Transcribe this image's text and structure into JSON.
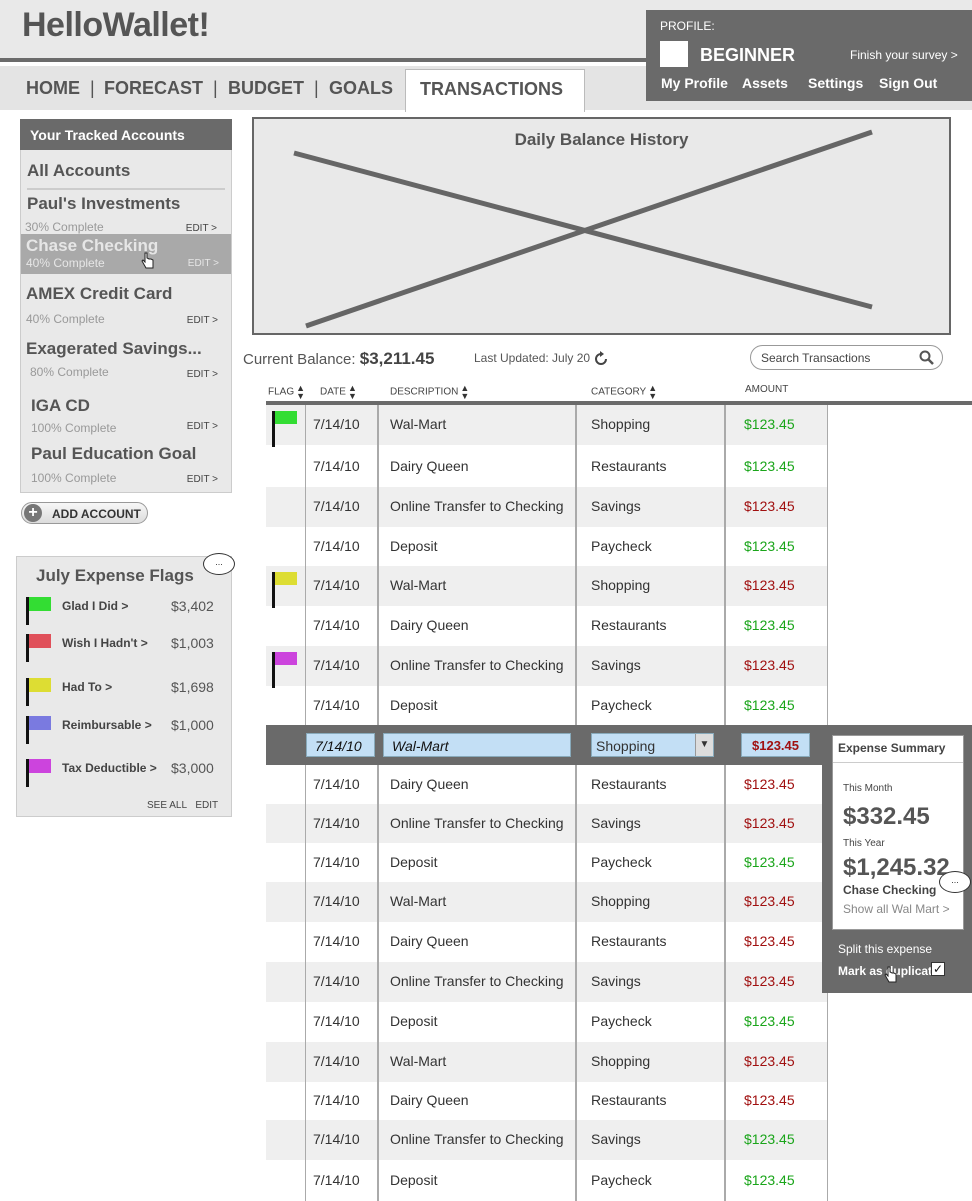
{
  "app": {
    "title": "HelloWallet!"
  },
  "nav": {
    "items": [
      "HOME",
      "FORECAST",
      "BUDGET",
      "GOALS",
      "TRANSACTIONS"
    ],
    "separator": "|",
    "active": "TRANSACTIONS"
  },
  "profile": {
    "label": "PROFILE:",
    "level": "BEGINNER",
    "survey_link": "Finish your survey >",
    "links": [
      "My Profile",
      "Assets",
      "Settings",
      "Sign Out"
    ]
  },
  "accounts": {
    "header": "Your Tracked Accounts",
    "all": "All Accounts",
    "items": [
      {
        "name": "Paul's Investments",
        "progress": "30% Complete",
        "edit": "EDIT >"
      },
      {
        "name": "Chase Checking",
        "progress": "40% Complete",
        "edit": "EDIT >"
      },
      {
        "name": "AMEX Credit Card",
        "progress": "40% Complete",
        "edit": "EDIT >"
      },
      {
        "name": "Exagerated Savings...",
        "progress": "80% Complete",
        "edit": "EDIT >"
      },
      {
        "name": "IGA CD",
        "progress": "100% Complete",
        "edit": "EDIT >"
      },
      {
        "name": "Paul Education Goal",
        "progress": "100% Complete",
        "edit": "EDIT >"
      }
    ],
    "selected": "Chase Checking",
    "add_button": "ADD ACCOUNT",
    "add_icon": "plus-icon"
  },
  "flags": {
    "title": "July Expense Flags",
    "bubble": "...",
    "items": [
      {
        "label": "Glad I Did >",
        "amount": "$3,402",
        "color": "#33dd33"
      },
      {
        "label": "Wish I Hadn't >",
        "amount": "$1,003",
        "color": "#e0505a"
      },
      {
        "label": "Had To >",
        "amount": "$1,698",
        "color": "#dddd33"
      },
      {
        "label": "Reimbursable >",
        "amount": "$1,000",
        "color": "#7a7ae0"
      },
      {
        "label": "Tax Deductible >",
        "amount": "$3,000",
        "color": "#cc44dd"
      }
    ],
    "see_all": "SEE ALL",
    "edit": "EDIT"
  },
  "chart": {
    "title": "Daily Balance History",
    "placeholder": "image-placeholder-x"
  },
  "balance": {
    "label": "Current Balance:",
    "value": "$3,211.45",
    "updated": "Last Updated: July 20",
    "refresh_icon": "refresh-icon"
  },
  "search": {
    "placeholder": "Search Transactions",
    "icon": "search-icon"
  },
  "columns": [
    "FLAG",
    "DATE",
    "DESCRIPTION",
    "CATEGORY",
    "AMOUNT"
  ],
  "transactions": [
    {
      "date": "7/14/10",
      "desc": "Wal-Mart",
      "cat": "Shopping",
      "amt": "$123.45",
      "color": "green",
      "flag": "#33dd33"
    },
    {
      "date": "7/14/10",
      "desc": "Dairy Queen",
      "cat": "Restaurants",
      "amt": "$123.45",
      "color": "green",
      "flag": ""
    },
    {
      "date": "7/14/10",
      "desc": "Online Transfer to Checking",
      "cat": "Savings",
      "amt": "$123.45",
      "color": "red",
      "flag": ""
    },
    {
      "date": "7/14/10",
      "desc": "Deposit",
      "cat": "Paycheck",
      "amt": "$123.45",
      "color": "green",
      "flag": ""
    },
    {
      "date": "7/14/10",
      "desc": "Wal-Mart",
      "cat": "Shopping",
      "amt": "$123.45",
      "color": "red",
      "flag": "#dddd33"
    },
    {
      "date": "7/14/10",
      "desc": "Dairy Queen",
      "cat": "Restaurants",
      "amt": "$123.45",
      "color": "green",
      "flag": ""
    },
    {
      "date": "7/14/10",
      "desc": "Online Transfer to Checking",
      "cat": "Savings",
      "amt": "$123.45",
      "color": "red",
      "flag": "#cc44dd"
    },
    {
      "date": "7/14/10",
      "desc": "Deposit",
      "cat": "Paycheck",
      "amt": "$123.45",
      "color": "green",
      "flag": ""
    },
    {
      "date": "7/14/10",
      "desc": "Wal-Mart",
      "cat": "Shopping",
      "amt": "$123.45",
      "color": "red",
      "flag": "",
      "selected": true
    },
    {
      "date": "7/14/10",
      "desc": "Dairy Queen",
      "cat": "Restaurants",
      "amt": "$123.45",
      "color": "red",
      "flag": ""
    },
    {
      "date": "7/14/10",
      "desc": "Online Transfer to Checking",
      "cat": "Savings",
      "amt": "$123.45",
      "color": "red",
      "flag": ""
    },
    {
      "date": "7/14/10",
      "desc": "Deposit",
      "cat": "Paycheck",
      "amt": "$123.45",
      "color": "green",
      "flag": ""
    },
    {
      "date": "7/14/10",
      "desc": "Wal-Mart",
      "cat": "Shopping",
      "amt": "$123.45",
      "color": "red",
      "flag": ""
    },
    {
      "date": "7/14/10",
      "desc": "Dairy Queen",
      "cat": "Restaurants",
      "amt": "$123.45",
      "color": "red",
      "flag": ""
    },
    {
      "date": "7/14/10",
      "desc": "Online Transfer to Checking",
      "cat": "Savings",
      "amt": "$123.45",
      "color": "red",
      "flag": ""
    },
    {
      "date": "7/14/10",
      "desc": "Deposit",
      "cat": "Paycheck",
      "amt": "$123.45",
      "color": "green",
      "flag": ""
    },
    {
      "date": "7/14/10",
      "desc": "Wal-Mart",
      "cat": "Shopping",
      "amt": "$123.45",
      "color": "red",
      "flag": ""
    },
    {
      "date": "7/14/10",
      "desc": "Dairy Queen",
      "cat": "Restaurants",
      "amt": "$123.45",
      "color": "red",
      "flag": ""
    },
    {
      "date": "7/14/10",
      "desc": "Online Transfer to Checking",
      "cat": "Savings",
      "amt": "$123.45",
      "color": "green",
      "flag": ""
    },
    {
      "date": "7/14/10",
      "desc": "Deposit",
      "cat": "Paycheck",
      "amt": "$123.45",
      "color": "green",
      "flag": ""
    }
  ],
  "summary": {
    "title": "Expense Summary",
    "month_label": "This Month",
    "month_value": "$332.45",
    "year_label": "This Year",
    "year_value": "$1,245.32",
    "account": "Chase Checking",
    "show_all": "Show all Wal Mart >",
    "split": "Split this expense",
    "duplicate": "Mark as duplicate",
    "bubble": "..."
  },
  "colors": {
    "green": "#1aa51a",
    "red": "#a01010",
    "panel": "#6a6a6a",
    "selected_field": "#c3dff5"
  }
}
